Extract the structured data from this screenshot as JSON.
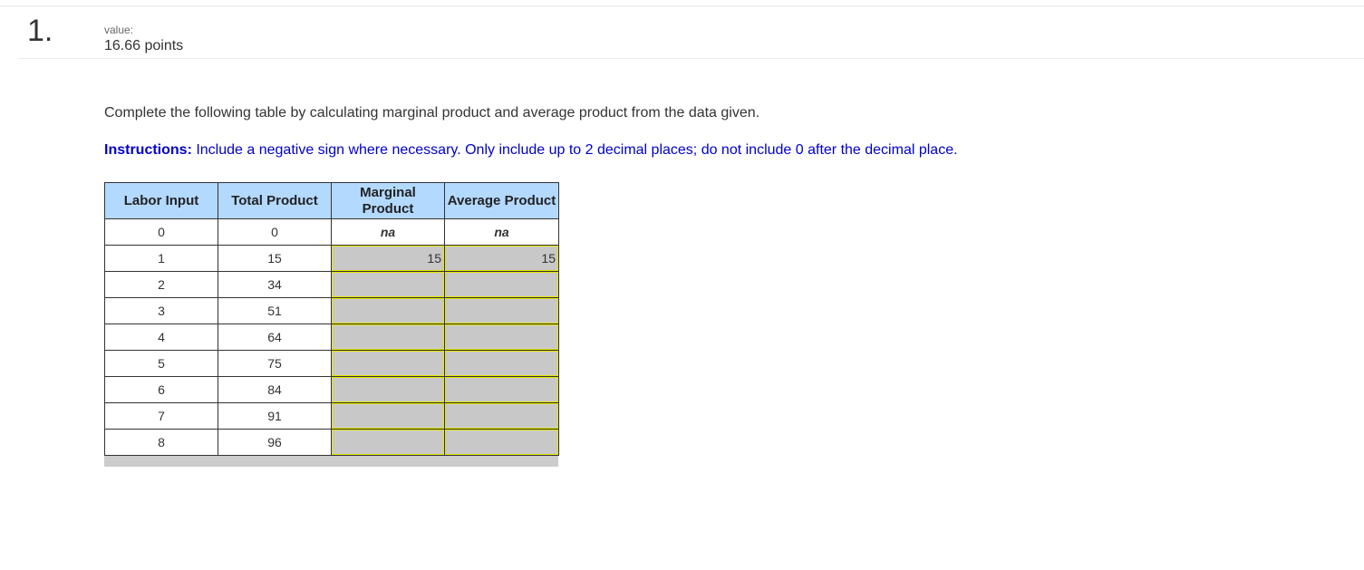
{
  "question": {
    "number": "1.",
    "value_label": "value:",
    "value_points": "16.66 points"
  },
  "prompt": "Complete the following table by calculating marginal product and average product from the data given.",
  "instructions": {
    "label": "Instructions:",
    "text": " Include a negative sign where necessary. Only include up to 2 decimal places; do not include 0 after the decimal place."
  },
  "table": {
    "headers": [
      "Labor Input",
      "Total Product",
      "Marginal Product",
      "Average Product"
    ],
    "na_row": {
      "labor": "0",
      "total": "0",
      "marginal": "na",
      "average": "na"
    },
    "rows": [
      {
        "labor": "1",
        "total": "15",
        "marginal": "15",
        "average": "15"
      },
      {
        "labor": "2",
        "total": "34",
        "marginal": "",
        "average": ""
      },
      {
        "labor": "3",
        "total": "51",
        "marginal": "",
        "average": ""
      },
      {
        "labor": "4",
        "total": "64",
        "marginal": "",
        "average": ""
      },
      {
        "labor": "5",
        "total": "75",
        "marginal": "",
        "average": ""
      },
      {
        "labor": "6",
        "total": "84",
        "marginal": "",
        "average": ""
      },
      {
        "labor": "7",
        "total": "91",
        "marginal": "",
        "average": ""
      },
      {
        "labor": "8",
        "total": "96",
        "marginal": "",
        "average": ""
      }
    ]
  },
  "colors": {
    "header_bg": "#b3d9ff",
    "input_bg": "#c8c8c8",
    "input_border": "#e5e500",
    "instructions_text": "#0000cc"
  }
}
